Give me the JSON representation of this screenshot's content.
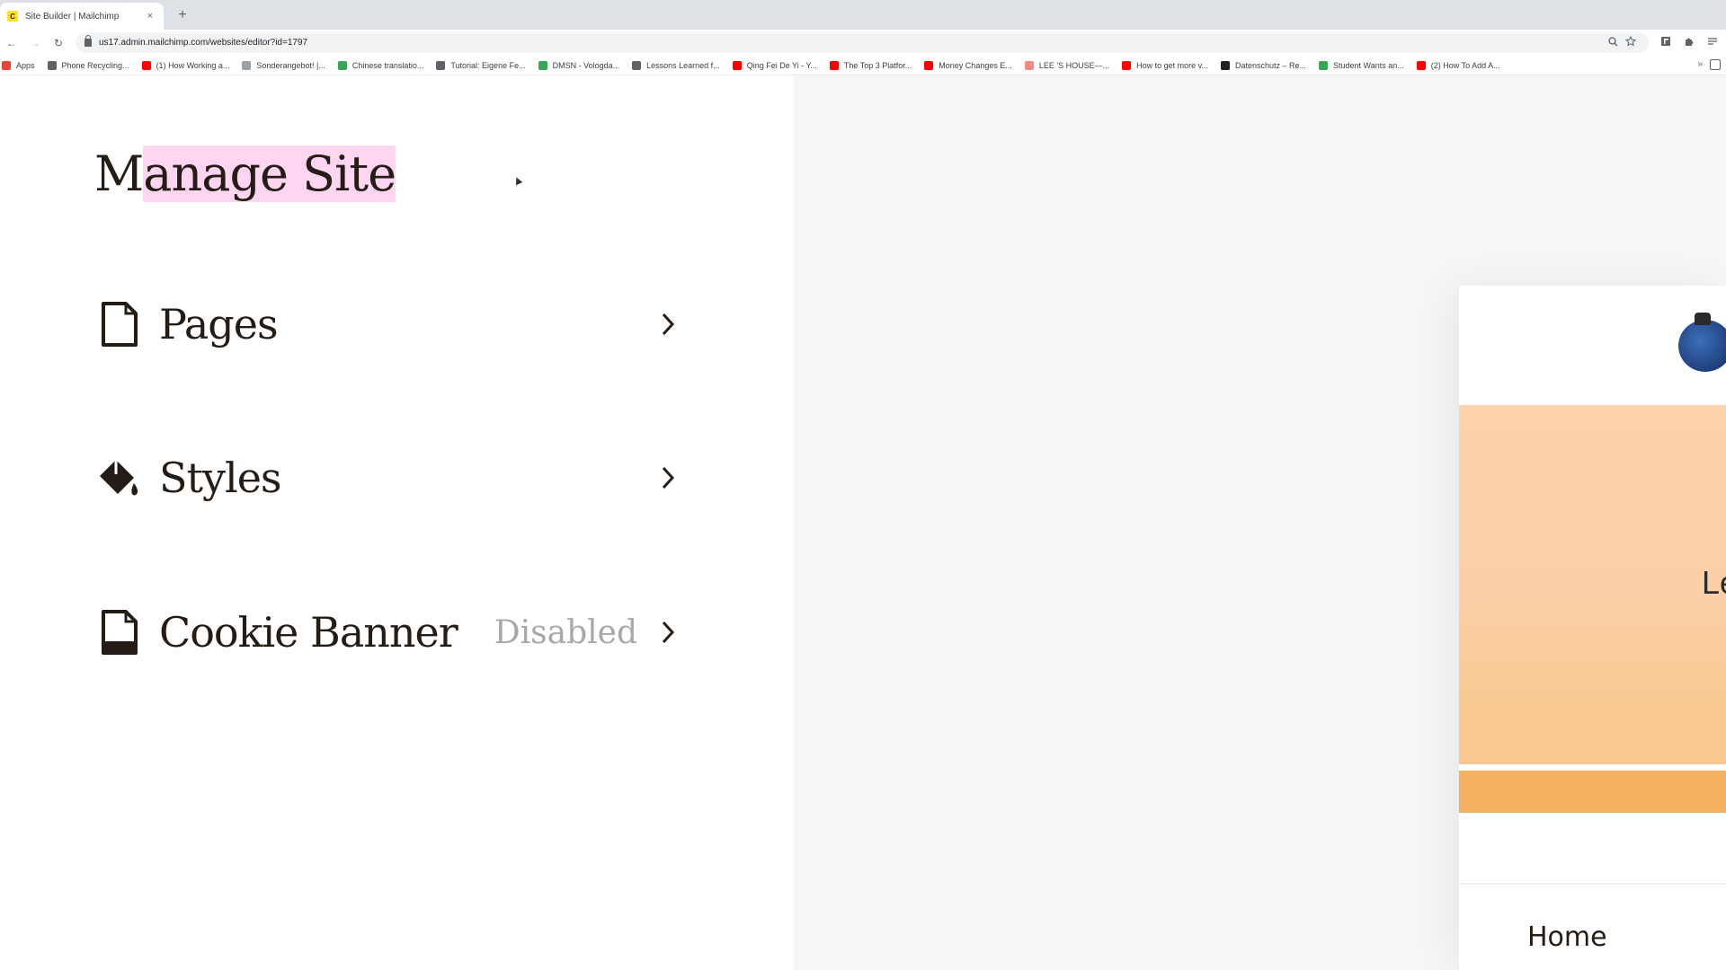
{
  "browser": {
    "tab_title": "Site Builder | Mailchimp",
    "tab_favicon_letter": "C",
    "tab_close": "×",
    "new_tab": "+",
    "nav": {
      "back": "←",
      "forward": "→",
      "reload": "↻"
    },
    "url": "us17.admin.mailchimp.com/websites/editor?id=1797",
    "bookmarks": [
      {
        "label": "Apps",
        "color": "#ea4335"
      },
      {
        "label": "Phone Recycling...",
        "color": "#5f6368"
      },
      {
        "label": "(1) How Working a...",
        "color": "#ff0000"
      },
      {
        "label": "Sonderangebot! |...",
        "color": "#9aa0a6"
      },
      {
        "label": "Chinese translatio...",
        "color": "#34a853"
      },
      {
        "label": "Tutorial: Eigene Fe...",
        "color": "#5f6368"
      },
      {
        "label": "DMSN - Vologda...",
        "color": "#34a853"
      },
      {
        "label": "Lessons Learned f...",
        "color": "#5f6368"
      },
      {
        "label": "Qing Fei De Yi - Y...",
        "color": "#ff0000"
      },
      {
        "label": "The Top 3 Platfor...",
        "color": "#ff0000"
      },
      {
        "label": "Money Changes E...",
        "color": "#ff0000"
      },
      {
        "label": "LEE 'S HOUSE—...",
        "color": "#f28b82"
      },
      {
        "label": "How to get more v...",
        "color": "#ff0000"
      },
      {
        "label": "Datenschutz – Re...",
        "color": "#202124"
      },
      {
        "label": "Student Wants an...",
        "color": "#34a853"
      },
      {
        "label": "(2) How To Add A...",
        "color": "#ff0000"
      }
    ],
    "bookmarks_more": "»"
  },
  "manage_site": {
    "title_first": "M",
    "title_rest": "anage Site",
    "items": {
      "pages": {
        "label": "Pages",
        "icon": "page-icon"
      },
      "styles": {
        "label": "Styles",
        "icon": "paint-bucket-icon"
      },
      "cookie": {
        "label": "Cookie Banner",
        "status": "Disabled",
        "icon": "cookie-document-icon"
      }
    }
  },
  "preview": {
    "hero_text": "Le",
    "nav_home": "Home"
  }
}
